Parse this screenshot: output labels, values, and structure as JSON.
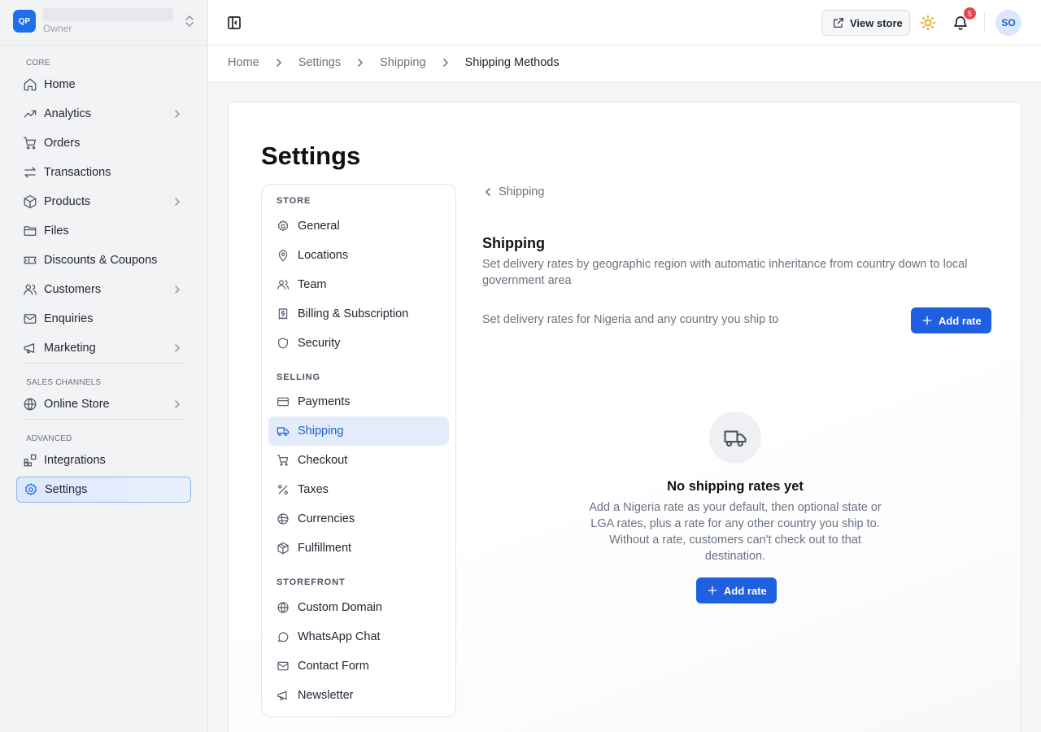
{
  "workspace": {
    "logo": "QP",
    "role": "Owner"
  },
  "sidebar": {
    "sections": [
      {
        "label": "CORE"
      },
      {
        "label": "SALES CHANNELS"
      },
      {
        "label": "ADVANCED"
      }
    ],
    "items": [
      {
        "label": "Home",
        "icon": "home-icon"
      },
      {
        "label": "Analytics",
        "icon": "trending-up-icon"
      },
      {
        "label": "Orders",
        "icon": "cart-icon"
      },
      {
        "label": "Transactions",
        "icon": "arrows-exchange-icon"
      },
      {
        "label": "Products",
        "icon": "box-icon"
      },
      {
        "label": "Files",
        "icon": "folder-icon"
      },
      {
        "label": "Discounts & Coupons",
        "icon": "ticket-icon"
      },
      {
        "label": "Customers",
        "icon": "users-icon"
      },
      {
        "label": "Enquiries",
        "icon": "mail-icon"
      },
      {
        "label": "Marketing",
        "icon": "megaphone-icon"
      },
      {
        "label": "Online Store",
        "icon": "globe-icon"
      },
      {
        "label": "Integrations",
        "icon": "blocks-icon"
      },
      {
        "label": "Settings",
        "icon": "gear-icon"
      }
    ]
  },
  "topbar": {
    "view_store": "View store",
    "notifications_count": "5",
    "avatar": "SO"
  },
  "breadcrumb": [
    "Home",
    "Settings",
    "Shipping",
    "Shipping Methods"
  ],
  "page": {
    "title": "Settings"
  },
  "settings_nav": {
    "sections": [
      {
        "label": "STORE"
      },
      {
        "label": "SELLING"
      },
      {
        "label": "STOREFRONT"
      }
    ],
    "items": [
      {
        "label": "General",
        "icon": "gear-icon"
      },
      {
        "label": "Locations",
        "icon": "map-pin-icon"
      },
      {
        "label": "Team",
        "icon": "users-icon"
      },
      {
        "label": "Billing & Subscription",
        "icon": "receipt-icon"
      },
      {
        "label": "Security",
        "icon": "shield-icon"
      },
      {
        "label": "Payments",
        "icon": "credit-card-icon"
      },
      {
        "label": "Shipping",
        "icon": "truck-icon"
      },
      {
        "label": "Checkout",
        "icon": "cart-icon"
      },
      {
        "label": "Taxes",
        "icon": "percent-icon"
      },
      {
        "label": "Currencies",
        "icon": "coins-icon"
      },
      {
        "label": "Fulfillment",
        "icon": "package-icon"
      },
      {
        "label": "Custom Domain",
        "icon": "globe-icon"
      },
      {
        "label": "WhatsApp Chat",
        "icon": "chat-icon"
      },
      {
        "label": "Contact Form",
        "icon": "mail-icon"
      },
      {
        "label": "Newsletter",
        "icon": "megaphone-icon"
      }
    ]
  },
  "shipping": {
    "back_label": "Shipping",
    "title": "Shipping",
    "description": "Set delivery rates by geographic region with automatic inheritance from country down to local government area",
    "subtitle": "Set delivery rates for Nigeria and any country you ship to",
    "add_rate": "Add rate",
    "empty_title": "No shipping rates yet",
    "empty_description": "Add a Nigeria rate as your default, then optional state or LGA rates, plus a rate for any other country you ship to. Without a rate, customers can't check out to that destination.",
    "empty_add_rate": "Add rate"
  },
  "colors": {
    "accent": "#1f5fe0",
    "active_bg": "#e4ecfb",
    "badge": "#e5484d",
    "sun": "#e3a21a"
  }
}
